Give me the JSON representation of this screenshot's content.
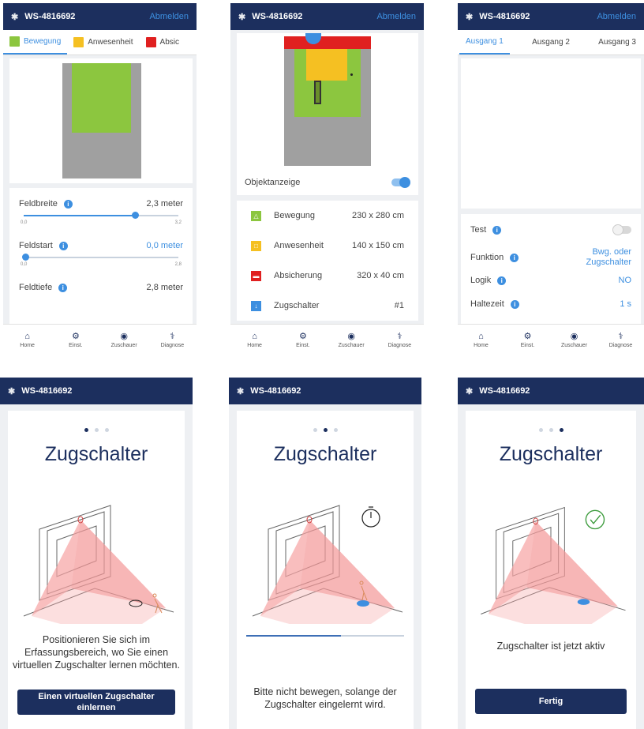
{
  "colors": {
    "navy": "#1c2f5e",
    "accent": "#3d8fe0",
    "green": "#8cc63f",
    "yellow": "#f5c022",
    "red": "#e02020",
    "gray": "#a0a0a0"
  },
  "header": {
    "device": "WS-4816692",
    "logout": "Abmelden",
    "bt_icon": "bluetooth-icon"
  },
  "nav": {
    "home": "Home",
    "settings": "Einst.",
    "viewer": "Zuschauer",
    "diag": "Diagnose"
  },
  "p1": {
    "tabs": [
      "Bewegung",
      "Anwesenheit",
      "Absic"
    ],
    "params": [
      {
        "label": "Feldbreite",
        "value": "2,3 meter",
        "min": "0,0",
        "max": "3,2",
        "fraction": 0.72
      },
      {
        "label": "Feldstart",
        "value": "0,0 meter",
        "min": "0,0",
        "max": "2,8",
        "fraction": 0.0
      },
      {
        "label": "Feldtiefe",
        "value": "2,8 meter"
      }
    ]
  },
  "p2": {
    "object_display": "Objektanzeige",
    "rows": [
      {
        "name": "Bewegung",
        "size": "230 x 280 cm",
        "icon": "motion-icon"
      },
      {
        "name": "Anwesenheit",
        "size": "140 x 150 cm",
        "icon": "presence-icon"
      },
      {
        "name": "Absicherung",
        "size": "320 x 40 cm",
        "icon": "safety-icon"
      },
      {
        "name": "Zugschalter",
        "size": "#1",
        "icon": "touchless-switch-icon"
      }
    ]
  },
  "p3": {
    "tabs": [
      "Ausgang 1",
      "Ausgang 2",
      "Ausgang 3"
    ],
    "test": "Test",
    "funktion": "Funktion",
    "funktion_val_1": "Bwg. oder",
    "funktion_val_2": "Zugschalter",
    "logik": "Logik",
    "logik_val": "NO",
    "haltezeit": "Haltezeit",
    "haltezeit_val": "1 s"
  },
  "wizard": {
    "title": "Zugschalter",
    "step1_text": "Positionieren Sie sich im Erfassungsbereich, wo Sie einen virtuellen Zugschalter lernen möchten.",
    "step1_btn": "Einen virtuellen Zugschalter einlernen",
    "step2_text": "Bitte nicht bewegen, solange der Zugschalter eingelernt wird.",
    "step2_progress": 0.6,
    "step3_text": "Zugschalter ist jetzt aktiv",
    "step3_btn": "Fertig"
  }
}
